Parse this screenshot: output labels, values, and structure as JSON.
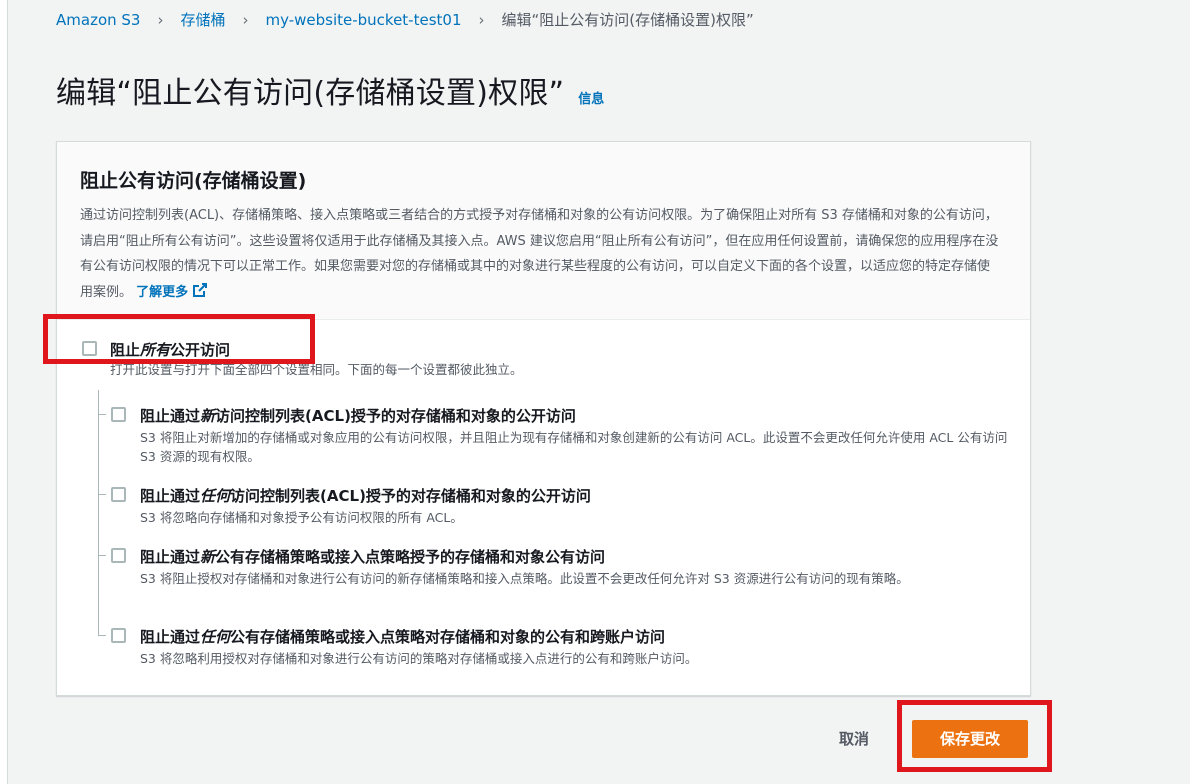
{
  "breadcrumb": {
    "items": [
      "Amazon S3",
      "存储桶",
      "my-website-bucket-test01"
    ],
    "current": "编辑“阻止公有访问(存储桶设置)权限”",
    "separator": "›"
  },
  "page": {
    "title": "编辑“阻止公有访问(存储桶设置)权限”",
    "info_link": "信息"
  },
  "panel": {
    "title": "阻止公有访问(存储桶设置)",
    "description": "通过访问控制列表(ACL)、存储桶策略、接入点策略或三者结合的方式授予对存储桶和对象的公有访问权限。为了确保阻止对所有 S3 存储桶和对象的公有访问，请启用“阻止所有公有访问”。这些设置将仅适用于此存储桶及其接入点。AWS 建议您启用“阻止所有公有访问”，但在应用任何设置前，请确保您的应用程序在没有公有访问权限的情况下可以正常工作。如果您需要对您的存储桶或其中的对象进行某些程度的公有访问，可以自定义下面的各个设置，以适应您的特定存储使用案例。",
    "learn_more": "了解更多"
  },
  "options": {
    "all": {
      "label_pre": "阻止",
      "label_em": "所有",
      "label_post": "公开访问",
      "desc": "打开此设置与打开下面全部四个设置相同。下面的每一个设置都彼此独立。",
      "checked": false
    },
    "sub": [
      {
        "label_pre": "阻止通过",
        "label_em": "新",
        "label_post": "访问控制列表(ACL)授予的对存储桶和对象的公开访问",
        "desc": "S3 将阻止对新增加的存储桶或对象应用的公有访问权限，并且阻止为现有存储桶和对象创建新的公有访问 ACL。此设置不会更改任何允许使用 ACL 公有访问 S3 资源的现有权限。",
        "checked": false
      },
      {
        "label_pre": "阻止通过",
        "label_em": "任何",
        "label_post": "访问控制列表(ACL)授予的对存储桶和对象的公开访问",
        "desc": "S3 将忽略向存储桶和对象授予公有访问权限的所有 ACL。",
        "checked": false
      },
      {
        "label_pre": "阻止通过",
        "label_em": "新",
        "label_post": "公有存储桶策略或接入点策略授予的存储桶和对象公有访问",
        "desc": "S3 将阻止授权对存储桶和对象进行公有访问的新存储桶策略和接入点策略。此设置不会更改任何允许对 S3 资源进行公有访问的现有策略。",
        "checked": false
      },
      {
        "label_pre": "阻止通过",
        "label_em": "任何",
        "label_post": "公有存储桶策略或接入点策略对存储桶和对象的公有和跨账户访问",
        "desc": "S3 将忽略利用授权对存储桶和对象进行公有访问的策略对存储桶或接入点进行的公有和跨账户访问。",
        "checked": false
      }
    ]
  },
  "footer": {
    "cancel_label": "取消",
    "save_label": "保存更改"
  },
  "colors": {
    "link": "#0073bb",
    "primary_button": "#ec7211",
    "highlight_box": "#e0161d"
  }
}
